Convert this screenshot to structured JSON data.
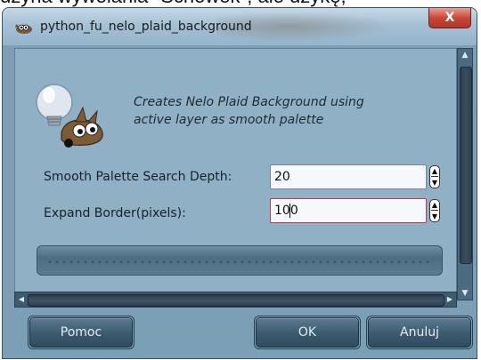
{
  "background_text": "dzyna wywołania \"Schowek\", ale dzykę,",
  "window": {
    "title": "python_fu_nelo_plaid_background",
    "close_label": "X"
  },
  "description": {
    "line1": "Creates Nelo Plaid Background using",
    "line2": "active layer as smooth palette"
  },
  "fields": [
    {
      "label": "Smooth Palette Search Depth:",
      "value": "20"
    },
    {
      "label": "Expand Border(pixels):",
      "value_before_caret": "10",
      "value_after_caret": "0"
    }
  ],
  "buttons": {
    "help": "Pomoc",
    "ok": "OK",
    "cancel": "Anuluj"
  },
  "progress": {
    "fraction": 0
  },
  "icons": [
    "wilber-icon",
    "spin-up-icon",
    "spin-down-icon",
    "close-icon"
  ]
}
